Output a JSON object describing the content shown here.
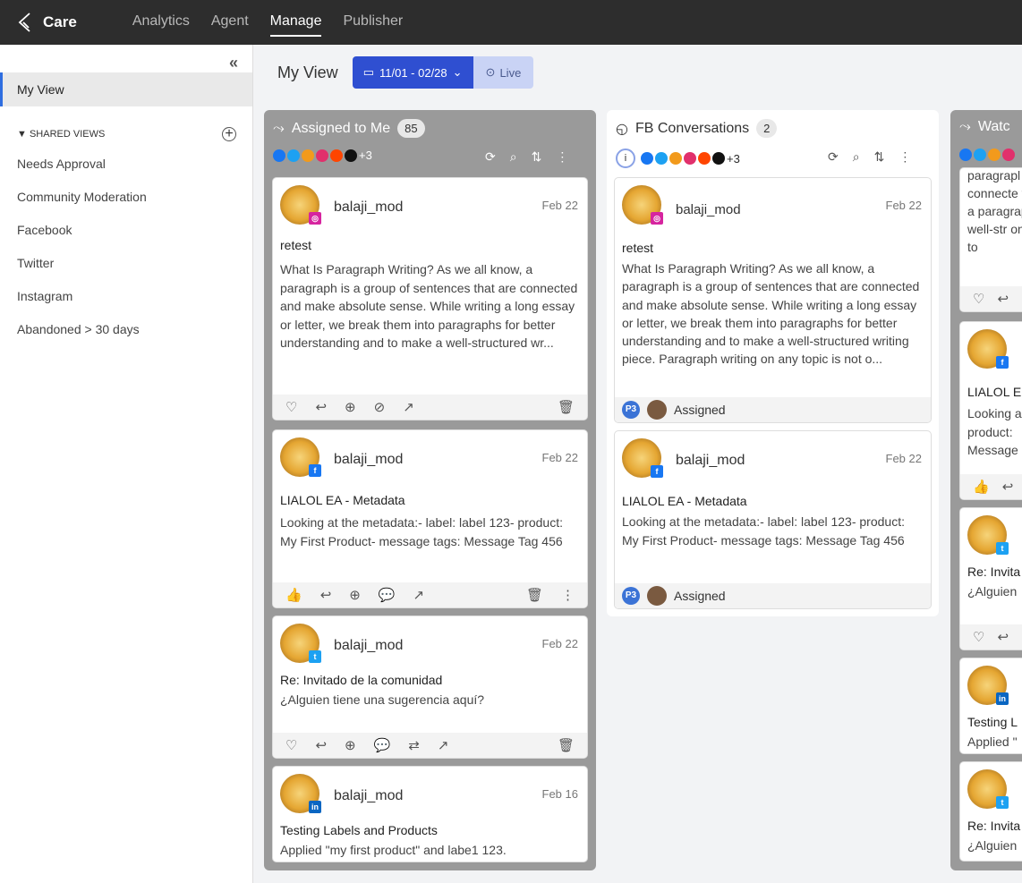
{
  "nav": {
    "brand": "Care",
    "items": [
      "Analytics",
      "Agent",
      "Manage",
      "Publisher"
    ],
    "active": "Manage"
  },
  "sidebar": {
    "current": "My View",
    "shared_header": "SHARED VIEWS",
    "views": [
      "Needs Approval",
      "Community Moderation",
      "Facebook",
      "Twitter",
      "Instagram",
      "Abandoned > 30 days"
    ]
  },
  "header": {
    "title": "My View",
    "date_range": "11/01 - 02/28",
    "live": "Live"
  },
  "columns": [
    {
      "title": "Assigned to Me",
      "count": "85",
      "more": "+3"
    },
    {
      "title": "FB Conversations",
      "count": "2",
      "more": "+3"
    },
    {
      "title": "Watc",
      "more": ""
    }
  ],
  "cards": {
    "c1": {
      "user": "balaji_mod",
      "date": "Feb 22",
      "subject": "retest",
      "text": "What Is Paragraph Writing? As we all know, a paragraph is a group of sentences that are connected and make absolute sense. While writing a long essay or letter, we break them into paragraphs for better understanding and to make a well-structured wr..."
    },
    "c2": {
      "user": "balaji_mod",
      "date": "Feb 22",
      "subject": "LIALOL EA - Metadata",
      "text": "Looking at the metadata:- label: label 123- product: My First Product- message tags: Message Tag 456"
    },
    "c3": {
      "user": "balaji_mod",
      "date": "Feb 22",
      "subject": "Re: Invitado de la comunidad",
      "text": "¿Alguien tiene una sugerencia aquí?"
    },
    "c4": {
      "user": "balaji_mod",
      "date": "Feb 16",
      "subject": "Testing Labels and Products",
      "text": "Applied \"my first product\" and labe1 123."
    },
    "f1": {
      "user": "balaji_mod",
      "date": "Feb 22",
      "subject": "retest",
      "text": "What Is Paragraph Writing? As we all know, a paragraph is a group of sentences that are connected and make absolute sense. While writing a long essay or letter, we break them into paragraphs for better understanding and to make a well-structured writing piece. Paragraph writing on any topic is not o...",
      "status": "Assigned",
      "priority": "P3"
    },
    "f2": {
      "user": "balaji_mod",
      "date": "Feb 22",
      "subject": "LIALOL EA - Metadata",
      "text": "Looking at the metadata:- label: label 123- product: My First Product- message tags: Message Tag 456",
      "status": "Assigned",
      "priority": "P3"
    },
    "w0": {
      "text": "paragrapl connecte writing a paragrapl a well-str on any to"
    },
    "w1": {
      "subject": "LIALOL E",
      "text": "Looking a product: Message"
    },
    "w2": {
      "subject": "Re: Invita",
      "text": "¿Alguien"
    },
    "w3": {
      "subject": "Testing L",
      "text": "Applied \""
    },
    "w4": {
      "subject": "Re: Invita",
      "text": "¿Alguien"
    }
  }
}
